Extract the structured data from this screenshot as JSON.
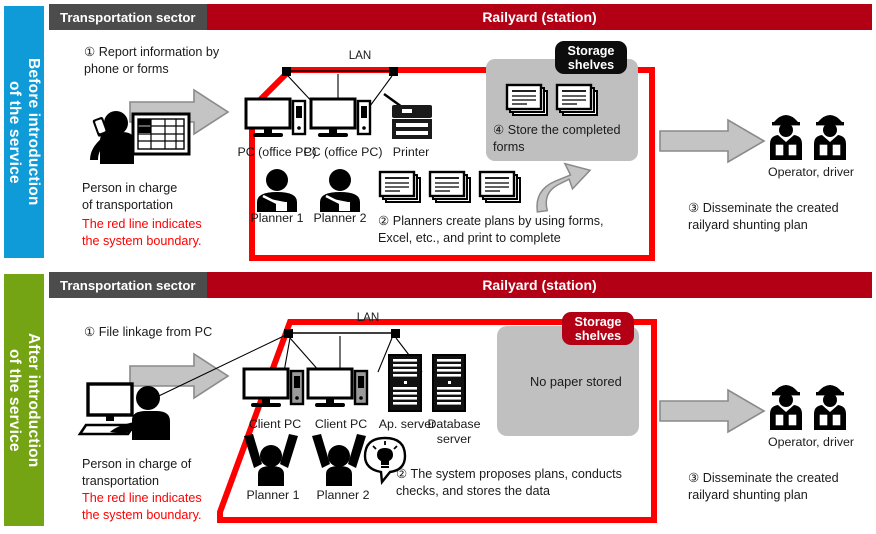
{
  "colors": {
    "brand_red": "#b40015",
    "boundary_red": "#ff0000",
    "header_gray": "#4c4c4c",
    "before_blue": "#0f9bd7",
    "after_green": "#74a313",
    "storage_gray": "#bfbfbf",
    "arrow_gray": "#bfbfbf"
  },
  "before": {
    "sidebar_label": "Before introduction\nof the service",
    "header_left": "Transportation sector",
    "header_right": "Railyard (station)",
    "step1": "① Report information by\n    phone or forms",
    "person_caption": "Person in charge\nof transportation",
    "boundary_note": "The red line indicates\nthe system boundary.",
    "lan_label": "LAN",
    "pc1_label": "PC (office PC)",
    "pc2_label": "PC (office PC)",
    "printer_label": "Printer",
    "planner1_label": "Planner 1",
    "planner2_label": "Planner 2",
    "step2": "② Planners create plans by using forms,\n     Excel, etc., and print to complete",
    "storage_tag": "Storage\nshelves",
    "step4": "④ Store the completed\n     forms",
    "operator_caption": "Operator, driver",
    "step3": "③ Disseminate the created\n     railyard shunting plan"
  },
  "after": {
    "sidebar_label": "After introduction\nof the service",
    "header_left": "Transportation sector",
    "header_right": "Railyard (station)",
    "step1": "① File linkage from PC",
    "person_caption": "Person in charge of\ntransportation",
    "boundary_note": "The red line indicates\nthe system boundary.",
    "lan_label": "LAN",
    "pc1_label": "Client PC",
    "pc2_label": "Client PC",
    "ap_server_label": "Ap. server",
    "db_server_label": "Database\nserver",
    "planner1_label": "Planner 1",
    "planner2_label": "Planner 2",
    "step2": "② The system proposes plans, conducts\n     checks, and stores the data",
    "storage_tag": "Storage\nshelves",
    "storage_text": "No paper stored",
    "operator_caption": "Operator, driver",
    "step3": "③ Disseminate the created\n     railyard shunting plan"
  }
}
